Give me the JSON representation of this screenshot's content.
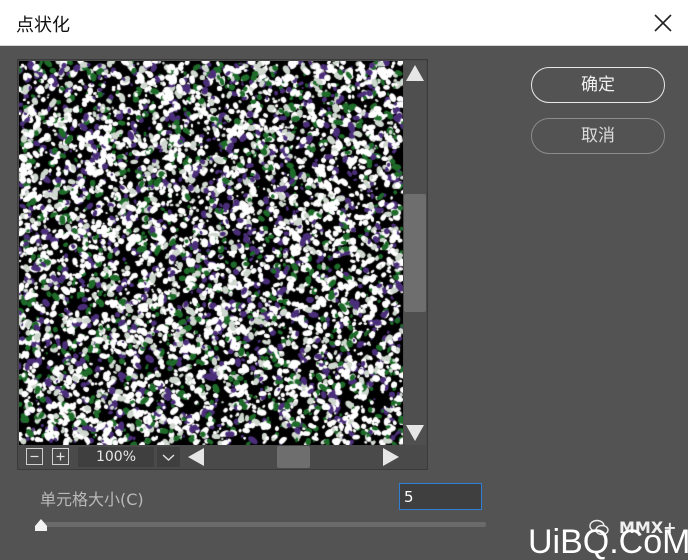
{
  "window": {
    "title": "点状化"
  },
  "buttons": {
    "ok_label": "确定",
    "cancel_label": "取消"
  },
  "preview": {
    "zoom_level": "100%"
  },
  "settings": {
    "cell_size_label": "单元格大小(C)",
    "cell_size_value": "5",
    "cell_size_slider": 0.0
  },
  "watermark": {
    "handle": "MMX+",
    "site": "UiBQ.CoM"
  },
  "icons": {
    "close": "close-icon",
    "zoom_out": "minus-icon",
    "zoom_in": "plus-icon",
    "dropdown": "chevron-down-icon",
    "scroll_up": "triangle-up-icon",
    "scroll_down": "triangle-down-icon",
    "scroll_left": "triangle-left-icon",
    "scroll_right": "triangle-right-icon",
    "wechat": "wechat-icon"
  },
  "colors": {
    "dialog_bg": "#535353",
    "accent": "#2f7fd6",
    "dot_white": "#ffffff",
    "dot_green": "#1e6b2a",
    "dot_purple": "#4b2e7a"
  }
}
